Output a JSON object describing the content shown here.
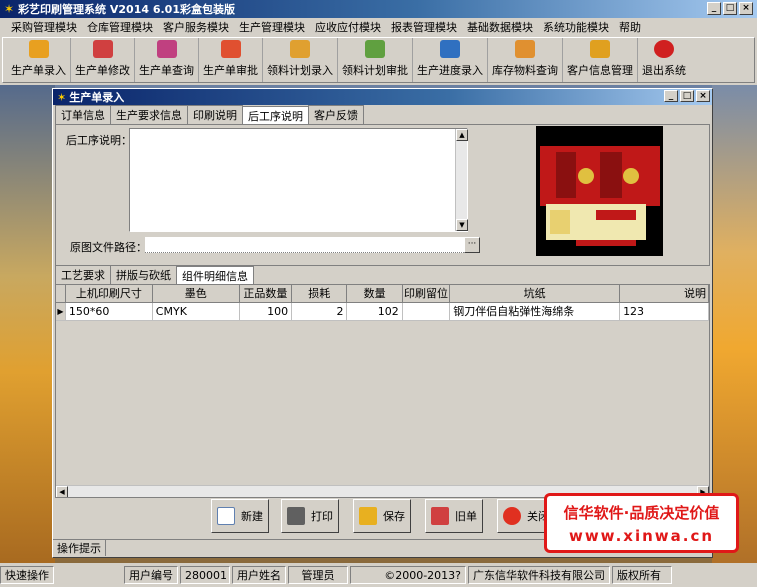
{
  "app": {
    "title": "彩艺印刷管理系统  V2014  6.01彩盒包装版"
  },
  "window_buttons": {
    "minimize": "_",
    "restore": "□",
    "close": "×"
  },
  "menu": [
    "采购管理模块",
    "仓库管理模块",
    "客户服务模块",
    "生产管理模块",
    "应收应付模块",
    "报表管理模块",
    "基础数据模块",
    "系统功能模块",
    "帮助"
  ],
  "toolbar": [
    {
      "label": "生产单录入",
      "icon": "box-icon",
      "color": "#e8a020"
    },
    {
      "label": "生产单修改",
      "icon": "books-icon",
      "color": "#d04040"
    },
    {
      "label": "生产单查询",
      "icon": "cubes-icon",
      "color": "#c04080"
    },
    {
      "label": "生产单审批",
      "icon": "gift-icon",
      "color": "#e05030"
    },
    {
      "label": "领料计划录入",
      "icon": "hand-icon",
      "color": "#e0a030"
    },
    {
      "label": "领料计划审批",
      "icon": "blocks-icon",
      "color": "#60a040"
    },
    {
      "label": "生产进度录入",
      "icon": "cubes-icon",
      "color": "#3070c0"
    },
    {
      "label": "库存物料查询",
      "icon": "stack-icon",
      "color": "#e09030"
    },
    {
      "label": "客户信息管理",
      "icon": "package-icon",
      "color": "#e0a020"
    },
    {
      "label": "退出系统",
      "icon": "exit-icon",
      "color": "#d02020"
    }
  ],
  "child_window": {
    "title": "生产单录入",
    "tabs": [
      "订单信息",
      "生产要求信息",
      "印刷说明",
      "后工序说明",
      "客户反馈"
    ],
    "active_tab": 3,
    "post_process_label": "后工序说明：",
    "post_process_value": "",
    "file_path_label": "原图文件路径：",
    "file_path_value": "",
    "browse_label": "···",
    "sub_tabs": [
      "工艺要求",
      "拼版与砍纸",
      "组件明细信息"
    ],
    "active_sub_tab": 2
  },
  "grid": {
    "columns": [
      "上机印刷尺寸",
      "墨色",
      "正品数量",
      "损耗",
      "数量",
      "印刷留位",
      "坑纸",
      "说明"
    ],
    "rows": [
      {
        "indicator": "▶",
        "size": "150*60",
        "ink": "CMYK",
        "good_qty": "100",
        "loss": "2",
        "qty": "102",
        "reserve": "",
        "flute": "钢刀伴侣自粘弹性海绵条",
        "note": "123"
      }
    ]
  },
  "actions": [
    {
      "label": "新建",
      "icon": "new-icon"
    },
    {
      "label": "打印",
      "icon": "printer-icon"
    },
    {
      "label": "保存",
      "icon": "save-icon"
    },
    {
      "label": "旧单",
      "icon": "old-order-icon"
    },
    {
      "label": "关闭",
      "icon": "close-circle-icon"
    }
  ],
  "hint_label": "操作提示",
  "watermark": {
    "line1": "信华软件·品质决定价值",
    "line2": "www.xinwa.cn"
  },
  "statusbar": {
    "quick_ops": "快速操作",
    "user_id_label": "用户编号",
    "user_id": "280001",
    "user_name_label": "用户姓名",
    "user_name": "管理员",
    "copyright": "©2000-2013?",
    "company": "广东信华软件科技有限公司",
    "rights": "版权所有"
  },
  "colors": {
    "title_bar": "#0a246a",
    "watermark_red": "#e01818",
    "window_bg": "#d4d0c8"
  }
}
